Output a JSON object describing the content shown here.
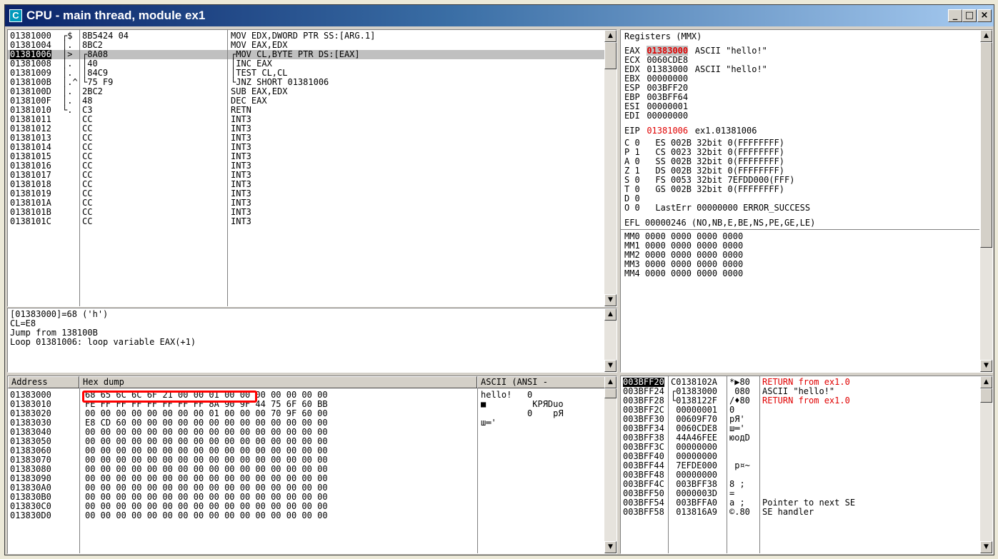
{
  "window": {
    "title": "CPU - main thread, module ex1",
    "icon_letter": "C"
  },
  "disasm": {
    "rows": [
      {
        "addr": "01381000",
        "mark": "┌$",
        "hex": "8B5424 04",
        "asm": "MOV EDX,DWORD PTR SS:[ARG.1]"
      },
      {
        "addr": "01381004",
        "mark": "│.",
        "hex": "8BC2",
        "asm": "MOV EAX,EDX"
      },
      {
        "addr": "01381006",
        "mark": "│>",
        "hex": "┌8A08",
        "asm": "┌MOV CL,BYTE PTR DS:[EAX]",
        "selected": true
      },
      {
        "addr": "01381008",
        "mark": "│.",
        "hex": "│40",
        "asm": "│INC EAX"
      },
      {
        "addr": "01381009",
        "mark": "│.",
        "hex": "│84C9",
        "asm": "│TEST CL,CL"
      },
      {
        "addr": "0138100B",
        "mark": "│.^",
        "hex": "└75 F9",
        "asm": "└JNZ SHORT 01381006"
      },
      {
        "addr": "0138100D",
        "mark": "│.",
        "hex": "2BC2",
        "asm": "SUB EAX,EDX"
      },
      {
        "addr": "0138100F",
        "mark": "│.",
        "hex": "48",
        "asm": "DEC EAX"
      },
      {
        "addr": "01381010",
        "mark": "└.",
        "hex": "C3",
        "asm": "RETN"
      },
      {
        "addr": "01381011",
        "mark": "",
        "hex": "CC",
        "asm": "INT3"
      },
      {
        "addr": "01381012",
        "mark": "",
        "hex": "CC",
        "asm": "INT3"
      },
      {
        "addr": "01381013",
        "mark": "",
        "hex": "CC",
        "asm": "INT3"
      },
      {
        "addr": "01381014",
        "mark": "",
        "hex": "CC",
        "asm": "INT3"
      },
      {
        "addr": "01381015",
        "mark": "",
        "hex": "CC",
        "asm": "INT3"
      },
      {
        "addr": "01381016",
        "mark": "",
        "hex": "CC",
        "asm": "INT3"
      },
      {
        "addr": "01381017",
        "mark": "",
        "hex": "CC",
        "asm": "INT3"
      },
      {
        "addr": "01381018",
        "mark": "",
        "hex": "CC",
        "asm": "INT3"
      },
      {
        "addr": "01381019",
        "mark": "",
        "hex": "CC",
        "asm": "INT3"
      },
      {
        "addr": "0138101A",
        "mark": "",
        "hex": "CC",
        "asm": "INT3"
      },
      {
        "addr": "0138101B",
        "mark": "",
        "hex": "CC",
        "asm": "INT3"
      },
      {
        "addr": "0138101C",
        "mark": "",
        "hex": "CC",
        "asm": "INT3"
      }
    ]
  },
  "info": {
    "lines": [
      "[01383000]=68 ('h')",
      "CL=E8",
      "Jump from 138100B",
      "Loop 01381006: loop variable EAX(+1)"
    ]
  },
  "registers": {
    "header": "Registers (MMX)",
    "gp": [
      {
        "name": "EAX",
        "value": "01383000",
        "comment": "ASCII \"hello!\"",
        "highlight": true
      },
      {
        "name": "ECX",
        "value": "0060CDE8",
        "comment": ""
      },
      {
        "name": "EDX",
        "value": "01383000",
        "comment": "ASCII \"hello!\""
      },
      {
        "name": "EBX",
        "value": "00000000",
        "comment": ""
      },
      {
        "name": "ESP",
        "value": "003BFF20",
        "comment": ""
      },
      {
        "name": "EBP",
        "value": "003BFF64",
        "comment": ""
      },
      {
        "name": "ESI",
        "value": "00000001",
        "comment": ""
      },
      {
        "name": "EDI",
        "value": "00000000",
        "comment": ""
      }
    ],
    "eip": {
      "name": "EIP",
      "value": "01381006",
      "comment": "ex1.01381006"
    },
    "flags": [
      "C 0   ES 002B 32bit 0(FFFFFFFF)",
      "P 1   CS 0023 32bit 0(FFFFFFFF)",
      "A 0   SS 002B 32bit 0(FFFFFFFF)",
      "Z 1   DS 002B 32bit 0(FFFFFFFF)",
      "S 0   FS 0053 32bit 7EFDD000(FFF)",
      "T 0   GS 002B 32bit 0(FFFFFFFF)",
      "D 0",
      "O 0   LastErr 00000000 ERROR_SUCCESS"
    ],
    "efl": "EFL 00000246 (NO,NB,E,BE,NS,PE,GE,LE)",
    "mmx": [
      "MM0 0000 0000 0000 0000",
      "MM1 0000 0000 0000 0000",
      "MM2 0000 0000 0000 0000",
      "MM3 0000 0000 0000 0000",
      "MM4 0000 0000 0000 0000"
    ]
  },
  "dump": {
    "col_address": "Address",
    "col_hex": "Hex dump",
    "col_ascii": "ASCII (ANSI -",
    "rows": [
      {
        "addr": "01383000",
        "hex": "68 65 6C 6C 6F 21 00 00 01 00 00 00 00 00 00 00",
        "ascii": "hello!   0      "
      },
      {
        "addr": "01383010",
        "hex": "FE FF FF FF FF FF FF FF 8A 90 9F 44 75 6F 60 BB",
        "ascii": "■         КРЯDuo"
      },
      {
        "addr": "01383020",
        "hex": "00 00 00 00 00 00 00 00 01 00 00 00 70 9F 60 00",
        "ascii": "         0    pЯ "
      },
      {
        "addr": "01383030",
        "hex": "E8 CD 60 00 00 00 00 00 00 00 00 00 00 00 00 00",
        "ascii": "ш═'             "
      },
      {
        "addr": "01383040",
        "hex": "00 00 00 00 00 00 00 00 00 00 00 00 00 00 00 00",
        "ascii": ""
      },
      {
        "addr": "01383050",
        "hex": "00 00 00 00 00 00 00 00 00 00 00 00 00 00 00 00",
        "ascii": ""
      },
      {
        "addr": "01383060",
        "hex": "00 00 00 00 00 00 00 00 00 00 00 00 00 00 00 00",
        "ascii": ""
      },
      {
        "addr": "01383070",
        "hex": "00 00 00 00 00 00 00 00 00 00 00 00 00 00 00 00",
        "ascii": ""
      },
      {
        "addr": "01383080",
        "hex": "00 00 00 00 00 00 00 00 00 00 00 00 00 00 00 00",
        "ascii": ""
      },
      {
        "addr": "01383090",
        "hex": "00 00 00 00 00 00 00 00 00 00 00 00 00 00 00 00",
        "ascii": ""
      },
      {
        "addr": "013830A0",
        "hex": "00 00 00 00 00 00 00 00 00 00 00 00 00 00 00 00",
        "ascii": ""
      },
      {
        "addr": "013830B0",
        "hex": "00 00 00 00 00 00 00 00 00 00 00 00 00 00 00 00",
        "ascii": ""
      },
      {
        "addr": "013830C0",
        "hex": "00 00 00 00 00 00 00 00 00 00 00 00 00 00 00 00",
        "ascii": ""
      },
      {
        "addr": "013830D0",
        "hex": "00 00 00 00 00 00 00 00 00 00 00 00 00 00 00 00",
        "ascii": ""
      }
    ]
  },
  "stack": {
    "rows": [
      {
        "addr": "003BFF20",
        "value": "C0138102A",
        "text": "*▶80",
        "comment": "RETURN from ex1.0",
        "top": true
      },
      {
        "addr": "003BFF24",
        "value": "┌01383000",
        "text": " 080",
        "comment": "ASCII \"hello!\""
      },
      {
        "addr": "003BFF28",
        "value": "└0138122F",
        "text": "/♦80",
        "comment": "RETURN from ex1.0",
        "red": true
      },
      {
        "addr": "003BFF2C",
        "value": " 00000001",
        "text": "0",
        "comment": ""
      },
      {
        "addr": "003BFF30",
        "value": " 00609F70",
        "text": "pЯ'",
        "comment": ""
      },
      {
        "addr": "003BFF34",
        "value": " 0060CDE8",
        "text": "ш═'",
        "comment": ""
      },
      {
        "addr": "003BFF38",
        "value": " 44A46FEE",
        "text": "юодD",
        "comment": ""
      },
      {
        "addr": "003BFF3C",
        "value": " 00000000",
        "text": "",
        "comment": ""
      },
      {
        "addr": "003BFF40",
        "value": " 00000000",
        "text": "",
        "comment": ""
      },
      {
        "addr": "003BFF44",
        "value": " 7EFDE000",
        "text": " р¤~",
        "comment": ""
      },
      {
        "addr": "003BFF48",
        "value": " 00000000",
        "text": "",
        "comment": ""
      },
      {
        "addr": "003BFF4C",
        "value": " 003BFF38",
        "text": "8 ;",
        "comment": ""
      },
      {
        "addr": "003BFF50",
        "value": " 0000003D",
        "text": "=",
        "comment": ""
      },
      {
        "addr": "003BFF54",
        "value": " 003BFFA0",
        "text": "а ;",
        "comment": "Pointer to next SE"
      },
      {
        "addr": "003BFF58",
        "value": " 013816A9",
        "text": "©.80",
        "comment": "SE handler"
      }
    ]
  },
  "colors": {
    "selection": "#c0c0c0",
    "register_changed": "#e00000",
    "highlight_box": "#ff0000"
  }
}
